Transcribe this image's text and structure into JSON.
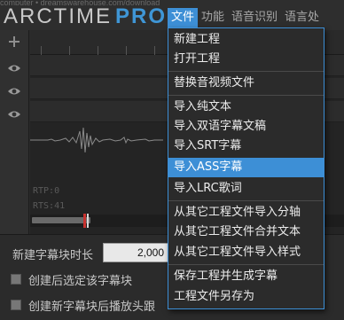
{
  "app": {
    "url_text": "computer • dreamswarehouse.com/download",
    "logo_main": "ARCTIME",
    "logo_accent": "PRO"
  },
  "menu": [
    {
      "label": "文件",
      "active": true
    },
    {
      "label": "功能",
      "active": false
    },
    {
      "label": "语音识别",
      "active": false
    },
    {
      "label": "语言处",
      "active": false
    }
  ],
  "track_panel": {
    "add_icon": "plus-icon",
    "eye_icon": "eye-icon"
  },
  "timeline": {
    "timestamp_1": "RTP:0",
    "timestamp_2": "RTS:41"
  },
  "bottom": {
    "duration_label": "新建字幕块时长",
    "duration_value": "2,000",
    "option_1": "创建后选定该字幕块",
    "option_2": "创建新字幕块后播放头跟"
  },
  "file_menu": [
    {
      "label": "新建工程",
      "highlighted": false
    },
    {
      "label": "打开工程",
      "highlighted": false
    },
    {
      "label": "替换音视频文件",
      "highlighted": false
    },
    {
      "label": "导入纯文本",
      "highlighted": false
    },
    {
      "label": "导入双语字幕文稿",
      "highlighted": false
    },
    {
      "label": "导入SRT字幕",
      "highlighted": false
    },
    {
      "label": "导入ASS字幕",
      "highlighted": true
    },
    {
      "label": "导入LRC歌词",
      "highlighted": false
    },
    {
      "label": "从其它工程文件导入分轴",
      "highlighted": false
    },
    {
      "label": "从其它工程文件合并文本",
      "highlighted": false
    },
    {
      "label": "从其它工程文件导入样式",
      "highlighted": false
    },
    {
      "label": "保存工程并生成字幕",
      "highlighted": false
    },
    {
      "label": "工程文件另存为",
      "highlighted": false
    }
  ],
  "colors": {
    "accent": "#3d8fd6",
    "logo_accent": "#3f96d6",
    "background": "#2b2b2b",
    "playhead": "#c8322f"
  }
}
